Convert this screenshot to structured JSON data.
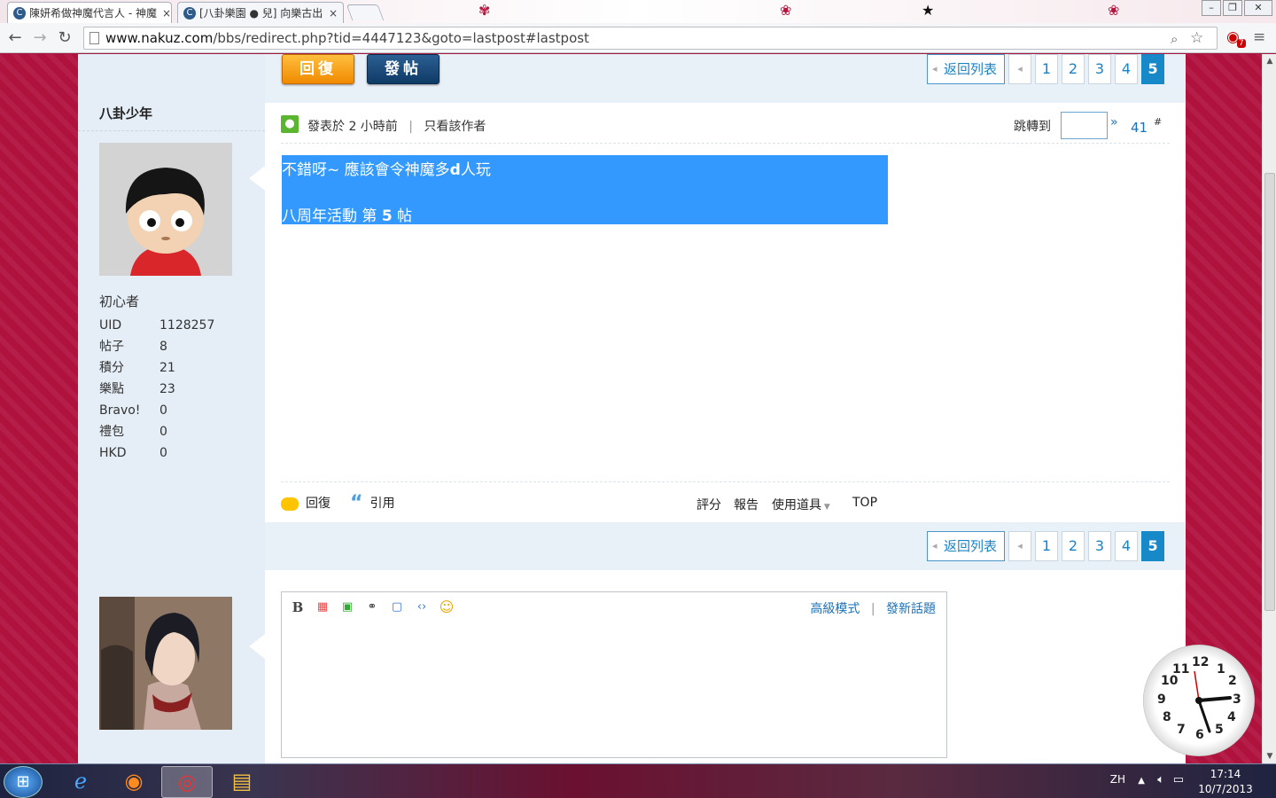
{
  "browser": {
    "tabs": [
      {
        "title": "陳妍希做神魔代言人 - 神魔"
      },
      {
        "title": "[八卦樂園 ● 兒] 向樂古出"
      }
    ],
    "url_host": "www.nakuz.com",
    "url_path": "/bbs/redirect.php?tid=4447123&goto=lastpost#lastpost",
    "ext_badge": "7"
  },
  "toolbar_top": {
    "reply_label": "回復",
    "post_label": "發帖"
  },
  "pagination": {
    "back_label": "返回列表",
    "pages": [
      "1",
      "2",
      "3",
      "4"
    ],
    "current": "5"
  },
  "post": {
    "author": "八卦少年",
    "rank": "初心者",
    "stats": [
      {
        "label": "UID",
        "value": "1128257"
      },
      {
        "label": "帖子",
        "value": "8"
      },
      {
        "label": "積分",
        "value": "21"
      },
      {
        "label": "樂點",
        "value": "23"
      },
      {
        "label": "Bravo!",
        "value": "0"
      },
      {
        "label": "禮包",
        "value": "0"
      },
      {
        "label": "HKD",
        "value": "0"
      }
    ],
    "posted_prefix": "發表於",
    "posted_time": "2 小時前",
    "only_author": "只看該作者",
    "jump_label": "跳轉到",
    "floor": "41",
    "floor_mark": "#",
    "message_line1": "不錯呀~ 應該會令神魔多",
    "message_bold": "d",
    "message_line1_end": "人玩",
    "message_line2": "八周年活動 第 ",
    "message_line2_num": "5",
    "message_line2_end": " 帖",
    "actions": {
      "reply": "回復",
      "quote": "引用",
      "rate": "評分",
      "report": "報告",
      "use_tool": "使用道具",
      "top": "TOP"
    }
  },
  "editor": {
    "advanced_mode": "高級模式",
    "new_topic": "發新話題"
  },
  "taskbar": {
    "lang": "ZH",
    "time": "17:14",
    "date": "10/7/2013"
  },
  "clock": {
    "numbers": [
      "12",
      "1",
      "2",
      "3",
      "4",
      "5",
      "6",
      "7",
      "8",
      "9",
      "10",
      "11"
    ]
  }
}
